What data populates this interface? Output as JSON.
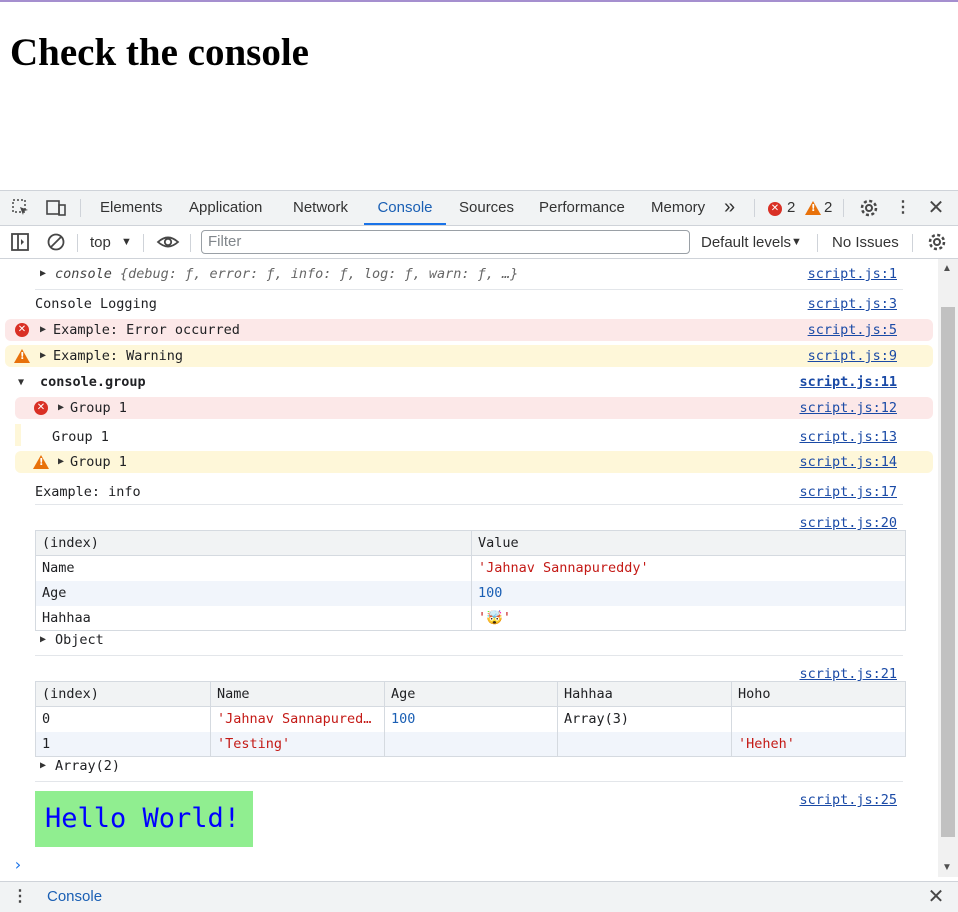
{
  "page": {
    "heading": "Check the console"
  },
  "devtools": {
    "tabs": [
      "Elements",
      "Application",
      "Network",
      "Console",
      "Sources",
      "Performance",
      "Memory"
    ],
    "active_tab": "Console",
    "more_tabs": "»",
    "error_count": "2",
    "warning_count": "2",
    "context": "top",
    "filter_placeholder": "Filter",
    "levels": "Default levels",
    "issues": "No Issues",
    "drawer_tab": "Console",
    "colors": {
      "accent": "#1a73e8",
      "error": "#d93025",
      "warning": "#e8710a"
    }
  },
  "console": {
    "rows": [
      {
        "text_name": "console",
        "text_props": "{debug: ƒ, error: ƒ, info: ƒ, log: ƒ, warn: ƒ, …}",
        "source": "script.js:1"
      },
      {
        "text": "Console Logging",
        "source": "script.js:3"
      },
      {
        "text": "Example: Error occurred",
        "source": "script.js:5"
      },
      {
        "text": "Example: Warning",
        "source": "script.js:9"
      },
      {
        "text": "console.group",
        "source": "script.js:11"
      },
      {
        "text": "Group 1",
        "source": "script.js:12"
      },
      {
        "text": "Group 1",
        "source": "script.js:13"
      },
      {
        "text": "Group 1",
        "source": "script.js:14"
      },
      {
        "text": "Example: info",
        "source": "script.js:17"
      }
    ],
    "table1": {
      "source": "script.js:20",
      "headers": [
        "(index)",
        "Value"
      ],
      "rows": [
        [
          "Name",
          "'Jahnav Sannapureddy'"
        ],
        [
          "Age",
          "100"
        ],
        [
          "Hahhaa",
          "'🤯'"
        ]
      ],
      "footer": "Object"
    },
    "table2": {
      "source": "script.js:21",
      "headers": [
        "(index)",
        "Name",
        "Age",
        "Hahhaa",
        "Hoho"
      ],
      "rows": [
        [
          "0",
          "'Jahnav Sannapured…",
          "100",
          "Array(3)",
          ""
        ],
        [
          "1",
          "'Testing'",
          "",
          "",
          "'Heheh'"
        ]
      ],
      "footer": "Array(2)"
    },
    "styled": {
      "text": "Hello World!",
      "source": "script.js:25"
    },
    "prompt": "›"
  }
}
